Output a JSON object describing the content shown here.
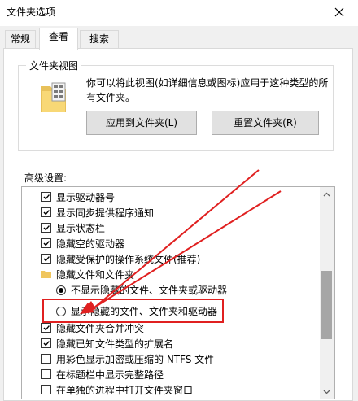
{
  "window": {
    "title": "文件夹选项"
  },
  "tabs": [
    {
      "label": "常规"
    },
    {
      "label": "查看"
    },
    {
      "label": "搜索"
    }
  ],
  "folder_views": {
    "title": "文件夹视图",
    "description_line1": "你可以将此视图(如详细信息或图标)应用于这种类型的所",
    "description_line2": "有文件夹。",
    "apply_button": "应用到文件夹(L)",
    "reset_button": "重置文件夹(R)"
  },
  "advanced": {
    "label": "高级设置:",
    "items": [
      {
        "label": "显示驱动器号",
        "checked": true
      },
      {
        "label": "显示同步提供程序通知",
        "checked": true
      },
      {
        "label": "显示状态栏",
        "checked": true
      },
      {
        "label": "隐藏空的驱动器",
        "checked": true
      },
      {
        "label": "隐藏受保护的操作系统文件(推荐)",
        "checked": true
      },
      {
        "label": "隐藏文件和文件夹"
      },
      {
        "label": "不显示隐藏的文件、文件夹或驱动器",
        "selected": true
      },
      {
        "label": "显示隐藏的文件、文件夹和驱动器",
        "selected": false
      },
      {
        "label": "隐藏文件夹合并冲突",
        "checked": true
      },
      {
        "label": "隐藏已知文件类型的扩展名",
        "checked": true
      },
      {
        "label": "用彩色显示加密或压缩的 NTFS 文件",
        "checked": false
      },
      {
        "label": "在标题栏中显示完整路径",
        "checked": false
      },
      {
        "label": "在单独的进程中打开文件夹窗口",
        "checked": false
      }
    ]
  },
  "annotation": {
    "color": "#e02020"
  }
}
